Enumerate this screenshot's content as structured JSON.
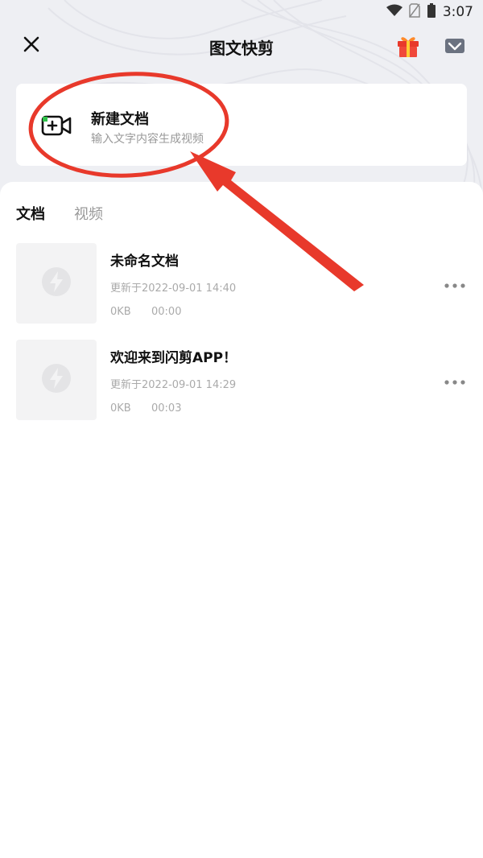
{
  "status_bar": {
    "time": "3:07"
  },
  "header": {
    "title": "图文快剪"
  },
  "new_doc": {
    "title": "新建文档",
    "subtitle": "输入文字内容生成视频"
  },
  "tabs": [
    {
      "label": "文档",
      "active": true
    },
    {
      "label": "视频",
      "active": false
    }
  ],
  "documents": [
    {
      "title": "未命名文档",
      "updated": "更新于2022-09-01 14:40",
      "size": "0KB",
      "duration": "00:00"
    },
    {
      "title": "欢迎来到闪剪APP！",
      "updated": "更新于2022-09-01 14:29",
      "size": "0KB",
      "duration": "00:03"
    }
  ],
  "colors": {
    "accent": "#e8392b",
    "background": "#eeeff3",
    "icon_green": "#2fc24a"
  }
}
